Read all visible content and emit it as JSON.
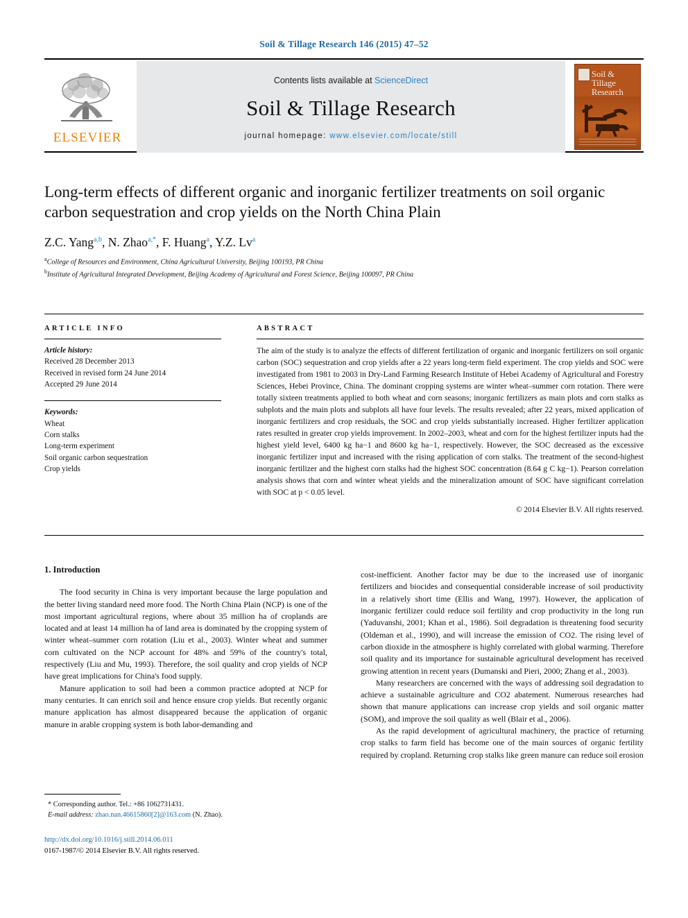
{
  "running_head": "Soil & Tillage Research 146 (2015) 47–52",
  "masthead": {
    "publisher_logo_text": "ELSEVIER",
    "contents_prefix": "Contents lists available at ",
    "contents_link": "ScienceDirect",
    "journal_name": "Soil & Tillage Research",
    "homepage_prefix": "journal homepage: ",
    "homepage_url": "www.elsevier.com/locate/still",
    "cover_title": "Soil & Tillage Research"
  },
  "article": {
    "title": "Long-term effects of different organic and inorganic fertilizer treatments on soil organic carbon sequestration and crop yields on the North China Plain",
    "authors": [
      {
        "name": "Z.C. Yang",
        "sup": "a,b"
      },
      {
        "name": "N. Zhao",
        "sup": "a,*"
      },
      {
        "name": "F. Huang",
        "sup": "a"
      },
      {
        "name": "Y.Z. Lv",
        "sup": "a"
      }
    ],
    "affiliations": [
      {
        "mark": "a",
        "text": "College of Resources and Environment, China Agricultural University, Beijing 100193, PR China"
      },
      {
        "mark": "b",
        "text": "Institute of Agricultural Integrated Development, Beijing Academy of Agricultural and Forest Science, Beijing 100097, PR China"
      }
    ]
  },
  "info": {
    "heading": "ARTICLE INFO",
    "history_label": "Article history:",
    "history": [
      "Received 28 December 2013",
      "Received in revised form 24 June 2014",
      "Accepted 29 June 2014"
    ],
    "keywords_label": "Keywords:",
    "keywords": [
      "Wheat",
      "Corn stalks",
      "Long-term experiment",
      "Soil organic carbon sequestration",
      "Crop yields"
    ]
  },
  "abstract": {
    "heading": "ABSTRACT",
    "text": "The aim of the study is to analyze the effects of different fertilization of organic and inorganic fertilizers on soil organic carbon (SOC) sequestration and crop yields after a 22 years long-term field experiment. The crop yields and SOC were investigated from 1981 to 2003 in Dry-Land Farming Research Institute of Hebei Academy of Agricultural and Forestry Sciences, Hebei Province, China. The dominant cropping systems are winter wheat–summer corn rotation. There were totally sixteen treatments applied to both wheat and corn seasons; inorganic fertilizers as main plots and corn stalks as subplots and the main plots and subplots all have four levels. The results revealed; after 22 years, mixed application of inorganic fertilizers and crop residuals, the SOC and crop yields substantially increased. Higher fertilizer application rates resulted in greater crop yields improvement. In 2002–2003, wheat and corn for the highest fertilizer inputs had the highest yield level, 6400 kg ha−1 and 8600 kg ha−1, respectively. However, the SOC decreased as the excessive inorganic fertilizer input and increased with the rising application of corn stalks. The treatment of the second-highest inorganic fertilizer and the highest corn stalks had the highest SOC concentration (8.64 g C kg−1). Pearson correlation analysis shows that corn and winter wheat yields and the mineralization amount of SOC have significant correlation with SOC at p < 0.05 level.",
    "copyright": "© 2014 Elsevier B.V. All rights reserved."
  },
  "body": {
    "section_title": "1. Introduction",
    "left_paragraphs": [
      "The food security in China is very important because the large population and the better living standard need more food. The North China Plain (NCP) is one of the most important agricultural regions, where about 35 million ha of croplands are located and at least 14 million ha of land area is dominated by the cropping system of winter wheat–summer corn rotation (Liu et al., 2003). Winter wheat and summer corn cultivated on the NCP account for 48% and 59% of the country's total, respectively (Liu and Mu, 1993). Therefore, the soil quality and crop yields of NCP have great implications for China's food supply.",
      "Manure application to soil had been a common practice adopted at NCP for many centuries. It can enrich soil and hence ensure crop yields. But recently organic manure application has almost disappeared because the application of organic manure in arable cropping system is both labor-demanding and"
    ],
    "right_paragraphs": [
      "cost-inefficient. Another factor may be due to the increased use of inorganic fertilizers and biocides and consequential considerable increase of soil productivity in a relatively short time (Ellis and Wang, 1997). However, the application of inorganic fertilizer could reduce soil fertility and crop productivity in the long run (Yaduvanshi, 2001; Khan et al., 1986). Soil degradation is threatening food security (Oldeman et al., 1990), and will increase the emission of CO2. The rising level of carbon dioxide in the atmosphere is highly correlated with global warming. Therefore soil quality and its importance for sustainable agricultural development has received growing attention in recent years (Dumanski and Pieri, 2000; Zhang et al., 2003).",
      "Many researchers are concerned with the ways of addressing soil degradation to achieve a sustainable agriculture and CO2 abatement. Numerous researches had shown that manure applications can increase crop yields and soil organic matter (SOM), and improve the soil quality as well (Blair et al., 2006).",
      "As the rapid development of agricultural machinery, the practice of returning crop stalks to farm field has become one of the main sources of organic fertility required by cropland. Returning crop stalks like green manure can reduce soil erosion"
    ]
  },
  "footnote": {
    "corresponding": "Corresponding author. Tel.: +86 1062731431.",
    "email_label": "E-mail address:",
    "email": "zhao.nan.46615860[2]@163.com",
    "email_suffix": "(N. Zhao).",
    "doi": "http://dx.doi.org/10.1016/j.still.2014.06.011",
    "issn_line": "0167-1987/© 2014 Elsevier B.V. All rights reserved."
  }
}
